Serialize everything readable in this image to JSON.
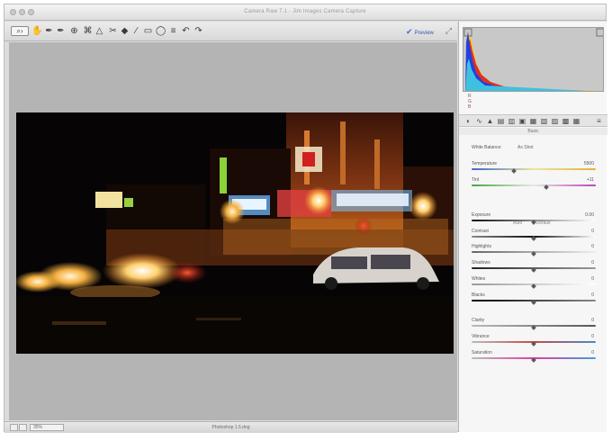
{
  "window": {
    "title": "Camera Raw 7.1  -  Jim Images Camera Capture"
  },
  "toolbar": {
    "tools": [
      "zoom-icon",
      "hand-icon",
      "white-balance-icon",
      "color-sampler-icon",
      "target-adjustment-icon",
      "crop-icon",
      "straighten-icon",
      "spot-removal-icon",
      "red-eye-icon",
      "adjustment-brush-icon",
      "graduated-filter-icon",
      "radial-filter-icon",
      "preferences-icon",
      "rotate-left-icon",
      "rotate-right-icon"
    ],
    "preview_label": "Preview"
  },
  "status": {
    "zoom": "35%",
    "label": "Photoshop 1.5.dng"
  },
  "panel": {
    "rgb": [
      "R",
      "G",
      "B"
    ],
    "header": "Basic",
    "white_balance_label": "White Balance:",
    "white_balance_value": "As Shot",
    "auto_label": "Auto",
    "default_label": "Default",
    "sliders": [
      {
        "name": "temperature",
        "label": "Temperature",
        "value": "5500",
        "position": 0.34
      },
      {
        "name": "tint",
        "label": "Tint",
        "value": "+11",
        "position": 0.6
      },
      {
        "name": "exposure",
        "label": "Exposure",
        "value": "0.00",
        "position": 0.5
      },
      {
        "name": "contrast",
        "label": "Contrast",
        "value": "0",
        "position": 0.5
      },
      {
        "name": "highlights",
        "label": "Highlights",
        "value": "0",
        "position": 0.5
      },
      {
        "name": "shadows",
        "label": "Shadows",
        "value": "0",
        "position": 0.5
      },
      {
        "name": "whites",
        "label": "Whites",
        "value": "0",
        "position": 0.5
      },
      {
        "name": "blacks",
        "label": "Blacks",
        "value": "0",
        "position": 0.5
      },
      {
        "name": "clarity",
        "label": "Clarity",
        "value": "0",
        "position": 0.5
      },
      {
        "name": "vibrance",
        "label": "Vibrance",
        "value": "0",
        "position": 0.5
      },
      {
        "name": "saturation",
        "label": "Saturation",
        "value": "0",
        "position": 0.5
      }
    ]
  },
  "colors": {
    "accent": "#3a56b8",
    "panel_bg": "#f6f6f6",
    "canvas_bg": "#b4b4b4"
  }
}
